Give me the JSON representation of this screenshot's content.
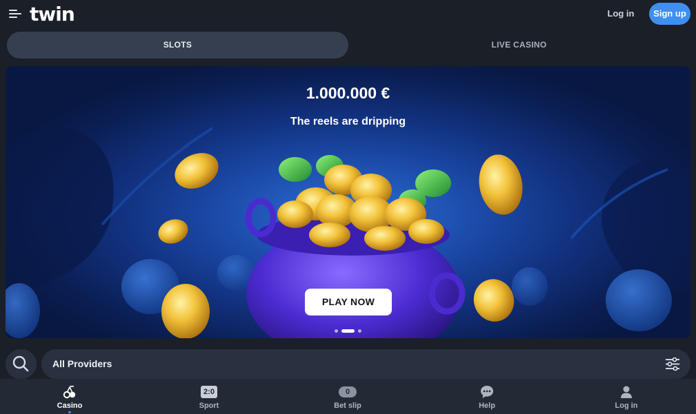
{
  "header": {
    "logo_text": "twin",
    "login_label": "Log in",
    "signup_label": "Sign up",
    "menu_icon": "hamburger-menu-icon",
    "accent_color": "#3f8ff0"
  },
  "tabs": [
    {
      "label": "SLOTS",
      "active": true
    },
    {
      "label": "LIVE CASINO",
      "active": false
    }
  ],
  "banner": {
    "title": "1.000.000 €",
    "subtitle": "The reels are dripping",
    "cta_label": "PLAY NOW",
    "slide_count": 3,
    "active_slide": 2
  },
  "filter": {
    "search_icon": "search-icon",
    "providers_label": "All Providers",
    "filter_icon": "sliders-icon"
  },
  "bottom_nav": {
    "items": [
      {
        "label": "Casino",
        "icon": "casino-cherries-icon",
        "active": true
      },
      {
        "label": "Sport",
        "icon": "scoreboard-icon",
        "badge": "2:0"
      },
      {
        "label": "Bet slip",
        "icon": "betslip-count-icon",
        "badge": "0"
      },
      {
        "label": "Help",
        "icon": "chat-help-icon"
      },
      {
        "label": "Log in",
        "icon": "user-icon"
      }
    ]
  }
}
